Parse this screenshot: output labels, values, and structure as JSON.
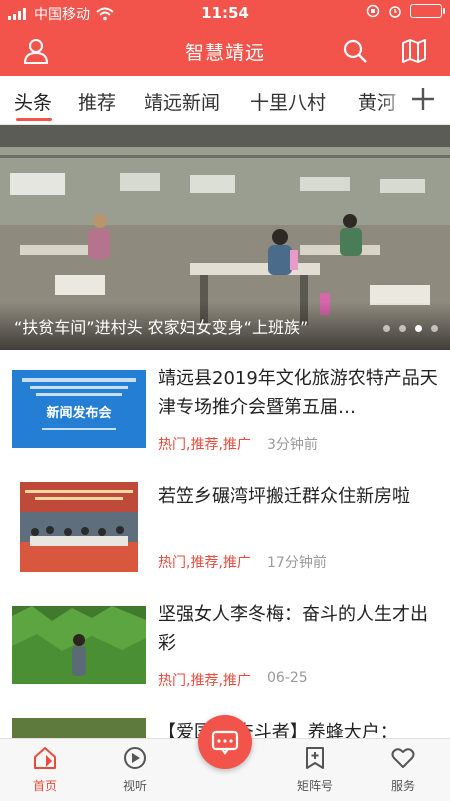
{
  "status_bar": {
    "carrier": "中国移动",
    "time": "11:54"
  },
  "header": {
    "title": "智慧靖远"
  },
  "tabs": [
    "头条",
    "推荐",
    "靖远新闻",
    "十里八村",
    "黄河"
  ],
  "banner": {
    "caption": "“扶贫车间”进村头 农家妇女变身“上班族”"
  },
  "news": [
    {
      "title": "靖远县2019年文化旅游农特产品天津专场推介会暨第五届…",
      "tags": "热门,推荐,推广",
      "time": "3分钟前",
      "thumb_text": "新闻发布会"
    },
    {
      "title": " 若笠乡碾湾坪搬迁群众住新房啦",
      "tags": "热门,推荐,推广",
      "time": "17分钟前"
    },
    {
      "title": "坚强女人李冬梅：奋斗的人生才出彩",
      "tags": "热门,推荐,推广",
      "time": "06-25"
    },
    {
      "title": "【爱国情 奋斗者】养蜂大户："
    }
  ],
  "tabbar": {
    "home": "首页",
    "audio": "视听",
    "matrix": "矩阵号",
    "service": "服务"
  },
  "colors": {
    "brand": "#f2544c",
    "tag": "#e94b3c"
  }
}
